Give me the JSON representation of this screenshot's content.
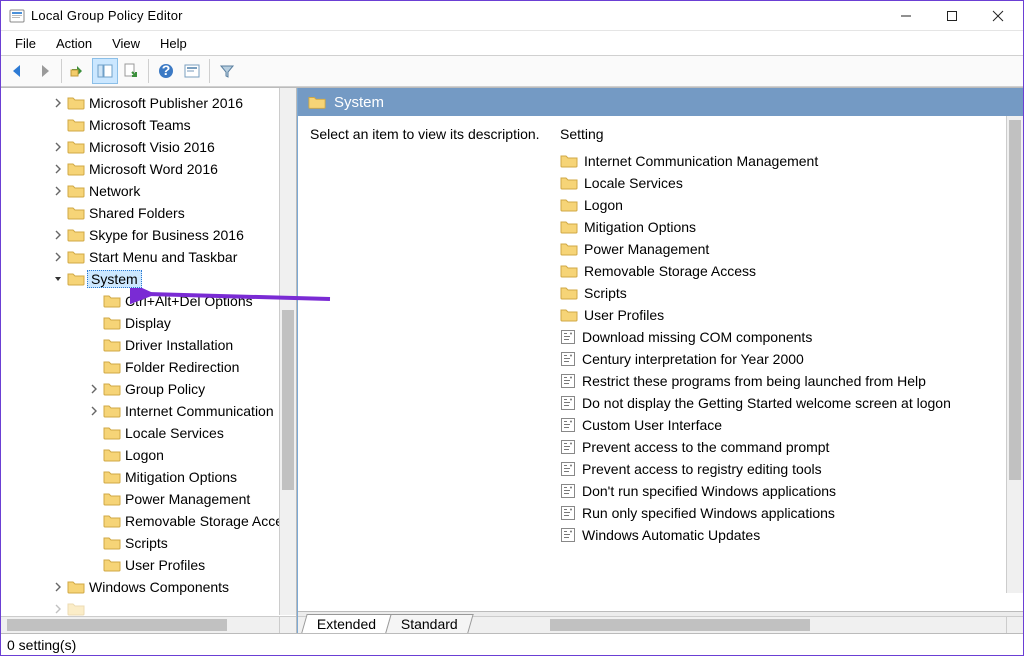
{
  "window": {
    "title": "Local Group Policy Editor"
  },
  "menu": [
    "File",
    "Action",
    "View",
    "Help"
  ],
  "tree": {
    "top": [
      {
        "label": "Microsoft Publisher 2016",
        "expand": true,
        "indent": "ind0"
      },
      {
        "label": "Microsoft Teams",
        "expand": false,
        "indent": "ind0"
      },
      {
        "label": "Microsoft Visio 2016",
        "expand": true,
        "indent": "ind0"
      },
      {
        "label": "Microsoft Word 2016",
        "expand": true,
        "indent": "ind0"
      },
      {
        "label": "Network",
        "expand": true,
        "indent": "ind0"
      },
      {
        "label": "Shared Folders",
        "expand": false,
        "indent": "ind0"
      },
      {
        "label": "Skype for Business 2016",
        "expand": true,
        "indent": "ind0"
      },
      {
        "label": "Start Menu and Taskbar",
        "expand": true,
        "indent": "ind0"
      }
    ],
    "selected": {
      "label": "System",
      "expand": "open",
      "indent": "ind-sys"
    },
    "children": [
      "Ctrl+Alt+Del Options",
      "Display",
      "Driver Installation",
      "Folder Redirection",
      "Group Policy",
      "Internet Communication",
      "Locale Services",
      "Logon",
      "Mitigation Options",
      "Power Management",
      "Removable Storage Acce",
      "Scripts",
      "User Profiles"
    ],
    "child_expand": {
      "4": true,
      "5": true
    },
    "after": [
      {
        "label": "Windows Components",
        "expand": true,
        "indent": "ind0"
      }
    ]
  },
  "right": {
    "header": "System",
    "description": "Select an item to view its description.",
    "col_header": "Setting",
    "folders": [
      "Internet Communication Management",
      "Locale Services",
      "Logon",
      "Mitigation Options",
      "Power Management",
      "Removable Storage Access",
      "Scripts",
      "User Profiles"
    ],
    "settings": [
      {
        "name": "Download missing COM components",
        "state": "N"
      },
      {
        "name": "Century interpretation for Year 2000",
        "state": "N"
      },
      {
        "name": "Restrict these programs from being launched from Help",
        "state": "N"
      },
      {
        "name": "Do not display the Getting Started welcome screen at logon",
        "state": "N"
      },
      {
        "name": "Custom User Interface",
        "state": "N"
      },
      {
        "name": "Prevent access to the command prompt",
        "state": "N"
      },
      {
        "name": "Prevent access to registry editing tools",
        "state": "N"
      },
      {
        "name": "Don't run specified Windows applications",
        "state": "N"
      },
      {
        "name": "Run only specified Windows applications",
        "state": "N"
      },
      {
        "name": "Windows Automatic Updates",
        "state": "N"
      }
    ]
  },
  "tabs": [
    {
      "label": "Extended",
      "active": true
    },
    {
      "label": "Standard",
      "active": false
    }
  ],
  "status": "0 setting(s)"
}
